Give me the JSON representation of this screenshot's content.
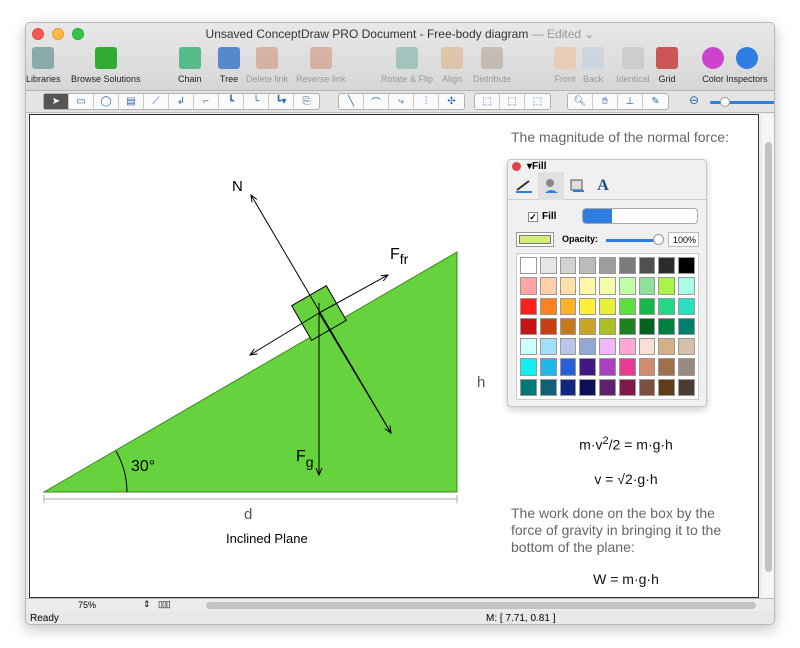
{
  "window": {
    "title": "Unsaved ConceptDraw PRO Document - Free-body diagram",
    "edited": "— Edited ⌄"
  },
  "toolbar": [
    {
      "label": "Libraries",
      "icon": "libraries-icon",
      "enabled": true
    },
    {
      "label": "Browse Solutions",
      "icon": "solutions-icon",
      "enabled": true
    },
    {
      "label": "Chain",
      "icon": "chain-icon",
      "enabled": true
    },
    {
      "label": "Tree",
      "icon": "tree-icon",
      "enabled": true
    },
    {
      "label": "Delete link",
      "icon": "delete-link-icon",
      "enabled": false
    },
    {
      "label": "Reverse link",
      "icon": "reverse-link-icon",
      "enabled": false
    },
    {
      "label": "Rotate & Flip",
      "icon": "rotate-flip-icon",
      "enabled": false
    },
    {
      "label": "Align",
      "icon": "align-icon",
      "enabled": false
    },
    {
      "label": "Distribute",
      "icon": "distribute-icon",
      "enabled": false
    },
    {
      "label": "Front",
      "icon": "front-icon",
      "enabled": false
    },
    {
      "label": "Back",
      "icon": "back-icon",
      "enabled": false
    },
    {
      "label": "Identical",
      "icon": "identical-icon",
      "enabled": false
    },
    {
      "label": "Grid",
      "icon": "grid-icon",
      "enabled": true
    },
    {
      "label": "Color",
      "icon": "color-wheel-icon",
      "enabled": true
    },
    {
      "label": "Inspectors",
      "icon": "info-icon",
      "enabled": true
    }
  ],
  "diagram": {
    "n": "N",
    "ffr": "F",
    "ffr_sub": "fr",
    "fg": "F",
    "fg_sub": "g",
    "angle": "30°",
    "h": "h",
    "d": "d",
    "caption": "Inclined Plane",
    "fill_color": "#66d33e"
  },
  "text": {
    "normal_force": "The magnitude of the normal force:",
    "f1_a": "m·v",
    "f1_sup": "2",
    "f1_b": "/2 = m·g·h",
    "f2": "v = √2·g·h",
    "work": "The work done on the box by the force of gravity in bringing it to the bottom of the plane:",
    "f3": "W = m·g·h"
  },
  "fill_panel": {
    "title": "Fill",
    "fill_label": "Fill",
    "fill_checked": true,
    "opacity_label": "Opacity:",
    "opacity": "100%",
    "opacity_value": 100,
    "current_color": "#d4f07a",
    "swatches": [
      "#ffffff",
      "#e6e6e6",
      "#d3d3d3",
      "#bcbcbc",
      "#9d9d9d",
      "#7c7c7c",
      "#505050",
      "#2c2c2c",
      "#000000",
      "#ffa5a5",
      "#ffd0a8",
      "#ffe0a8",
      "#fff7a8",
      "#f2ffa8",
      "#c0ffa8",
      "#8ee09c",
      "#a8f54a",
      "#a8ffe8",
      "#ff1e1e",
      "#ff8020",
      "#ffb428",
      "#ffee3a",
      "#e6f03a",
      "#5ede40",
      "#16b84a",
      "#20d886",
      "#28e0c0",
      "#c41414",
      "#c44014",
      "#c47a1c",
      "#c8a428",
      "#aec028",
      "#1e8220",
      "#006420",
      "#008040",
      "#00806c",
      "#ccffff",
      "#a0e0f8",
      "#b8c4e8",
      "#94a8d4",
      "#f0b8f8",
      "#ffa8d8",
      "#f8e0d4",
      "#d4b088",
      "#d4c0a8",
      "#14f0f0",
      "#20b8e8",
      "#2860d8",
      "#401a80",
      "#a840c0",
      "#e83c90",
      "#d08c6c",
      "#a0704a",
      "#988880",
      "#007878",
      "#106078",
      "#102880",
      "#0c1058",
      "#602070",
      "#801848",
      "#7c5040",
      "#603c18",
      "#4c3c34"
    ]
  },
  "footer": {
    "zoom": "75%",
    "status": "Ready",
    "coords": "M: [ 7.71, 0.81 ]"
  }
}
